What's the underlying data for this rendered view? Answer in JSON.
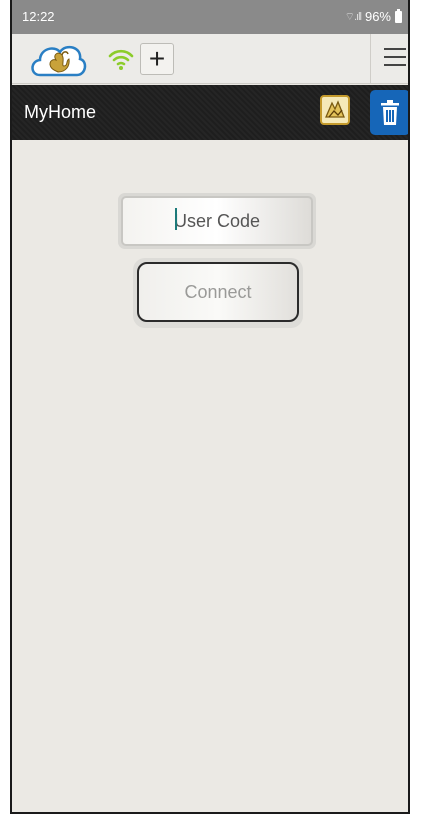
{
  "status_bar": {
    "time": "12:22",
    "signal": "⌔.ıll",
    "battery": "96%"
  },
  "toolbar": {
    "logo_icon": "swan-cloud-logo-icon",
    "wifi_icon": "wifi-icon",
    "add_label": "+",
    "menu_icon": "hamburger-menu-icon",
    "wifi_color": "#8ccc2a"
  },
  "title_bar": {
    "title": "MyHome",
    "scene_icon": "scene-icon",
    "delete_icon": "trash-icon",
    "delete_color": "#1666b8"
  },
  "form": {
    "user_code_placeholder": "User Code",
    "user_code_value": "",
    "connect_label": "Connect"
  }
}
